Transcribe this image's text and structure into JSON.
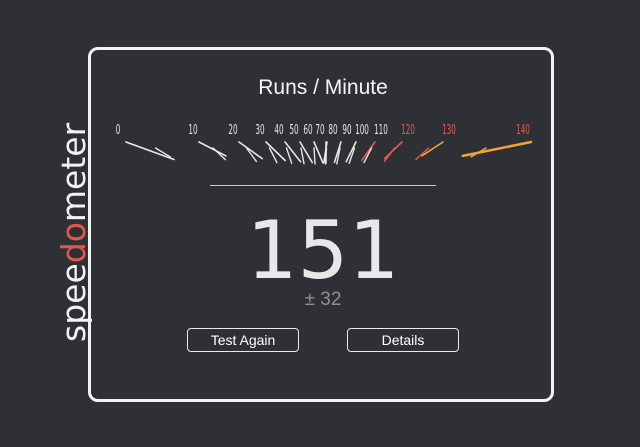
{
  "logo": {
    "part1": "spee",
    "part2": "do",
    "part3": "meter",
    "color_main": "#f2f2f2",
    "color_accent": "#e2574c"
  },
  "gauge": {
    "title": "Runs / Minute",
    "ticks": [
      "0",
      "10",
      "20",
      "30",
      "40",
      "50",
      "60",
      "70",
      "80",
      "90",
      "100",
      "110",
      "120",
      "130",
      "140"
    ],
    "color_normal": "#e6e6e6",
    "color_high": "#e05a50",
    "color_needle": "#f3a33a"
  },
  "result": {
    "score": "151",
    "error": "± 32"
  },
  "buttons": {
    "test_again": "Test Again",
    "details": "Details"
  }
}
